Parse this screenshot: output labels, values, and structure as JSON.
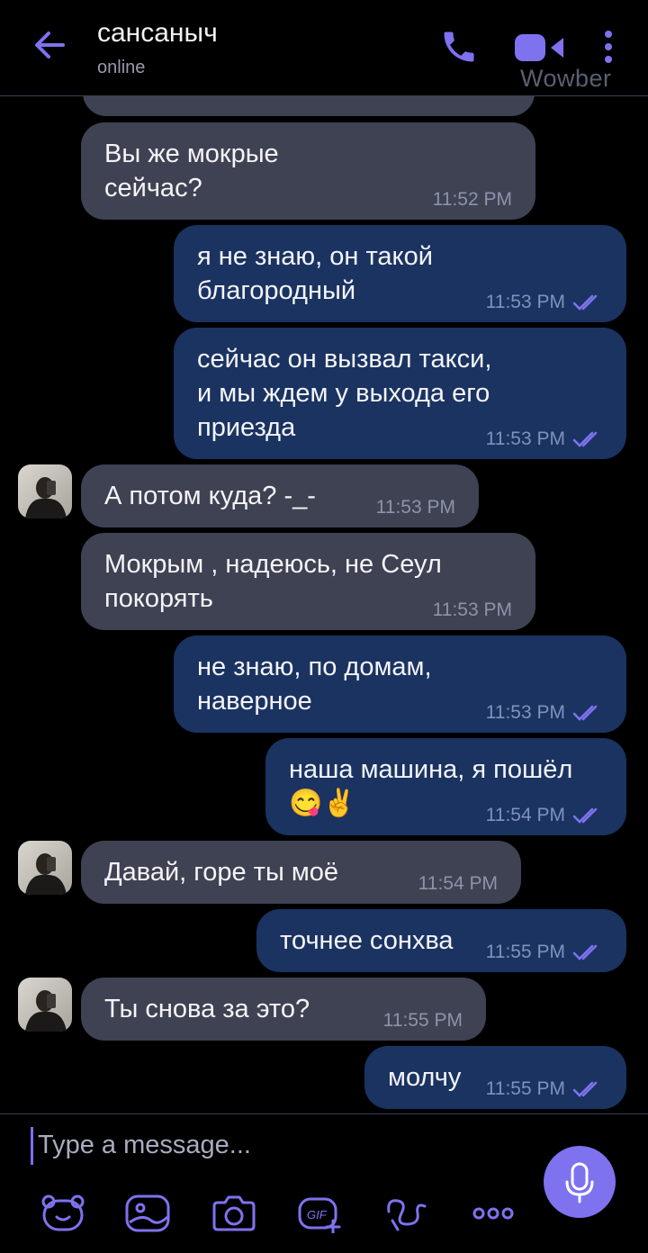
{
  "header": {
    "back_icon": "arrow-left-icon",
    "contact_name": "сансаныч",
    "status": "online",
    "call_icon": "phone-icon",
    "video_icon": "video-camera-icon",
    "menu_icon": "more-vertical-icon",
    "watermark": "Wowber"
  },
  "colors": {
    "accent": "#7e72ef",
    "incoming_bubble": "#3e4252",
    "outgoing_bubble": "#1a3361",
    "background": "#000000"
  },
  "messages": [
    {
      "dir": "in",
      "text": "Вы же мокрые\nсейчас?",
      "time": "11:52 PM"
    },
    {
      "dir": "out",
      "text": "я не знаю, он такой\nблагородный",
      "time": "11:53 PM",
      "read": true
    },
    {
      "dir": "out",
      "text": "сейчас он вызвал такси,\nи мы ждем у выхода его\nприезда",
      "time": "11:53 PM",
      "read": true
    },
    {
      "dir": "in",
      "text": "А потом куда? -_-",
      "time": "11:53 PM",
      "avatar": true
    },
    {
      "dir": "in",
      "text": "Мокрым , надеюсь, не Сеул\nпокорять",
      "time": "11:53 PM"
    },
    {
      "dir": "out",
      "text": "не знаю, по домам,\nнаверное",
      "time": "11:53 PM",
      "read": true
    },
    {
      "dir": "out",
      "text": "наша машина, я пошёл",
      "emoji": "😋✌️",
      "time": "11:54 PM",
      "read": true
    },
    {
      "dir": "in",
      "text": "Давай, горе ты моё",
      "time": "11:54 PM",
      "avatar": true
    },
    {
      "dir": "out",
      "text": "точнее сонхва",
      "time": "11:55 PM",
      "read": true
    },
    {
      "dir": "in",
      "text": "Ты снова за это?",
      "time": "11:55 PM",
      "avatar": true
    },
    {
      "dir": "out",
      "text": "молчу",
      "time": "11:55 PM",
      "read": true
    }
  ],
  "composer": {
    "placeholder": "Type a message...",
    "mic_icon": "microphone-icon",
    "tools": [
      "sticker-bear-icon",
      "gallery-icon",
      "camera-icon",
      "gif-icon",
      "doodle-icon",
      "more-horizontal-icon"
    ]
  }
}
